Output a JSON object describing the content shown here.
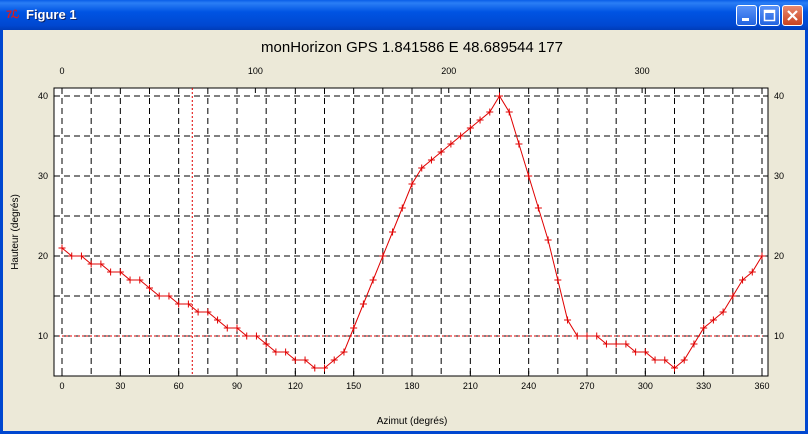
{
  "window": {
    "title": "Figure 1",
    "icon": "matlab-figure-icon",
    "buttons": [
      "minimize",
      "maximize",
      "close"
    ],
    "frame_color": "#0047d0",
    "background": "#ece9d8"
  },
  "chart_data": {
    "type": "line",
    "title": "monHorizon GPS 1.841586 E 48.689544 177",
    "xlabel": "Azimut (degrés)",
    "ylabel": "Hauteur (degrés)",
    "xlim": [
      0,
      360
    ],
    "ylim": [
      5,
      41
    ],
    "xticks": [
      0,
      30,
      60,
      90,
      120,
      150,
      180,
      210,
      240,
      270,
      300,
      330,
      360
    ],
    "yticks": [
      10,
      20,
      30,
      40
    ],
    "top_xlim": [
      0,
      362
    ],
    "top_xticks": [
      0,
      100,
      200,
      300
    ],
    "grid": true,
    "marker": "+",
    "color": "#e00000",
    "series": [
      {
        "x": [
          0,
          5,
          10,
          15,
          20,
          25,
          30,
          35,
          40,
          45,
          50,
          55,
          60,
          65,
          70,
          75,
          80,
          85,
          90,
          95,
          100,
          105,
          110,
          115,
          120,
          125,
          130,
          135,
          140,
          145,
          150,
          155,
          160,
          165,
          170,
          175,
          180,
          185,
          190,
          195,
          200,
          205,
          210,
          215,
          220,
          225,
          230,
          235,
          240,
          245,
          250,
          255,
          260,
          265,
          270,
          275,
          280,
          285,
          290,
          295,
          300,
          305,
          310,
          315,
          320,
          325,
          330,
          335,
          340,
          345,
          350,
          355,
          360
        ],
        "y": [
          21,
          20,
          20,
          19,
          19,
          18,
          18,
          17,
          17,
          16,
          15,
          15,
          14,
          14,
          13,
          13,
          12,
          11,
          11,
          10,
          10,
          9,
          8,
          8,
          7,
          7,
          6,
          6,
          7,
          8,
          11,
          14,
          17,
          20,
          23,
          26,
          29,
          31,
          32,
          33,
          34,
          35,
          36,
          37,
          38,
          40,
          38,
          34,
          30,
          26,
          22,
          17,
          12,
          10,
          10,
          10,
          9,
          9,
          9,
          8,
          8,
          7,
          7,
          6,
          7,
          9,
          11,
          12,
          13,
          15,
          17,
          18,
          20
        ]
      }
    ],
    "reference_lines": [
      {
        "orientation": "horizontal",
        "value": 10,
        "style": "dotted",
        "color": "#e00000"
      },
      {
        "orientation": "vertical",
        "value": 67,
        "style": "dotted",
        "color": "#e00000"
      }
    ]
  }
}
